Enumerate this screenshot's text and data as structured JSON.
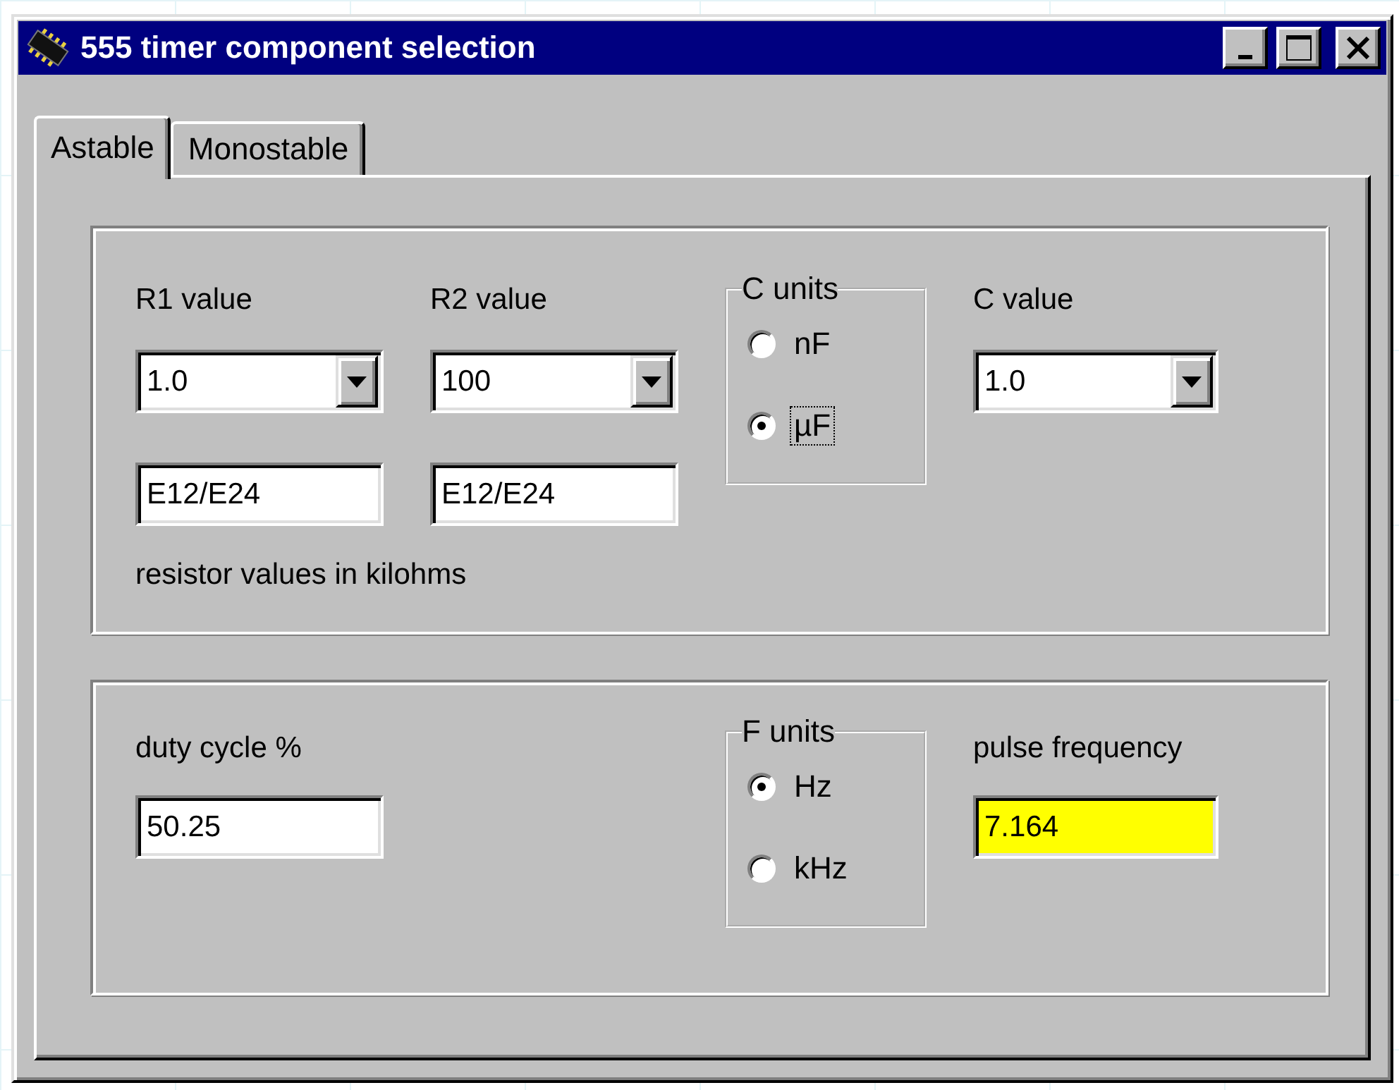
{
  "window": {
    "title": "555 timer component selection"
  },
  "tabs": [
    {
      "label": "Astable",
      "selected": true
    },
    {
      "label": "Monostable",
      "selected": false
    }
  ],
  "resistor_group": {
    "r1": {
      "label": "R1 value",
      "value": "1.0",
      "series": "E12/E24"
    },
    "r2": {
      "label": "R2 value",
      "value": "100",
      "series": "E12/E24"
    },
    "c_units": {
      "legend": "C units",
      "options": [
        {
          "label": "nF",
          "selected": false,
          "focused": false
        },
        {
          "label": "µF",
          "selected": true,
          "focused": true
        }
      ]
    },
    "c_value": {
      "label": "C value",
      "value": "1.0"
    },
    "note": "resistor values in kilohms"
  },
  "frequency_group": {
    "duty_cycle": {
      "label": "duty cycle %",
      "value": "50.25"
    },
    "f_units": {
      "legend": "F units",
      "options": [
        {
          "label": "Hz",
          "selected": true,
          "focused": false
        },
        {
          "label": "kHz",
          "selected": false,
          "focused": false
        }
      ]
    },
    "pulse_frequency": {
      "label": "pulse frequency",
      "value": "7.164"
    }
  }
}
